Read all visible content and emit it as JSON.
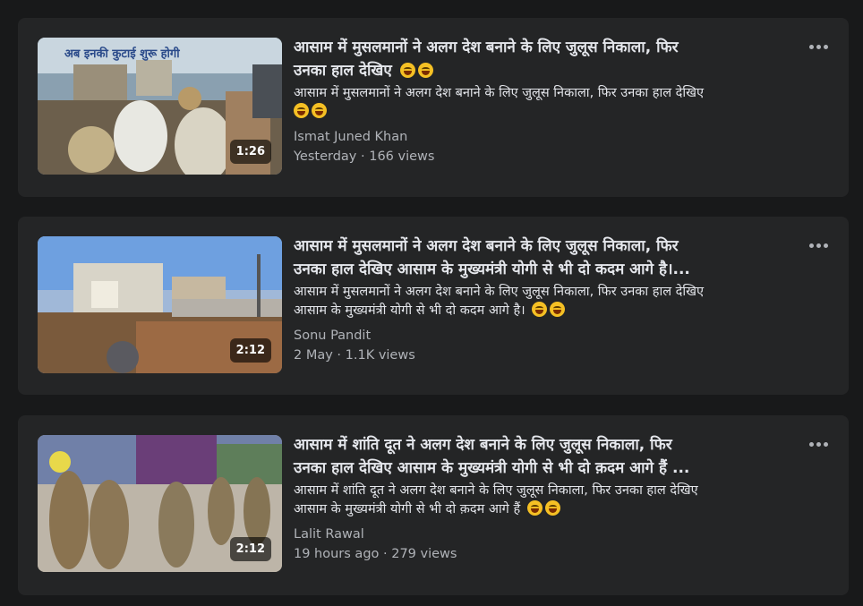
{
  "feed": {
    "items": [
      {
        "title": "आसाम में मुसलमानों ने अलग देश बनाने के लिए जुलूस निकाला, फिर",
        "title_line2": "उनका हाल देखिए",
        "title_emojis": [
          "😂",
          "😂"
        ],
        "desc_line1": "आसाम में मुसलमानों ने अलग देश बनाने के लिए जुलूस निकाला, फिर उनका हाल देखिए",
        "desc_line2": "",
        "desc_emojis": [
          "😂",
          "😂"
        ],
        "author": "Ismat Juned Khan",
        "meta": "Yesterday · 166 views",
        "duration": "1:26",
        "thumb_caption": "अब इनकी कुटाई शुरू होगी"
      },
      {
        "title": "आसाम में मुसलमानों ने अलग देश बनाने के लिए जुलूस निकाला, फिर",
        "title_line2": "उनका हाल देखिए आसाम के मुख्यमंत्री योगी से भी दो कदम आगे है।...",
        "desc_line1": "आसाम में मुसलमानों ने अलग देश बनाने के लिए जुलूस निकाला, फिर उनका हाल देखिए",
        "desc_line2": "आसाम के मुख्यमंत्री योगी से भी दो कदम आगे है।",
        "desc_emojis": [
          "😂",
          "😂"
        ],
        "author": "Sonu Pandit",
        "meta": "2 May · 1.1K views",
        "duration": "2:12"
      },
      {
        "title": "आसाम में शांति दूत ने अलग देश बनाने के लिए जुलूस निकाला, फिर",
        "title_line2": "उनका हाल देखिए आसाम के मुख्यमंत्री योगी से भी दो क़दम आगे हैं ...",
        "desc_line1": "आसाम में शांति दूत ने अलग देश बनाने के लिए जुलूस निकाला, फिर उनका हाल देखिए",
        "desc_line2": "आसाम के मुख्यमंत्री योगी से भी दो क़दम आगे हैं",
        "desc_emojis": [
          "😂",
          "😂"
        ],
        "author": "Lalit Rawal",
        "meta": "19 hours ago · 279 views",
        "duration": "2:12"
      }
    ]
  },
  "colors": {
    "page_bg": "#18191a",
    "card_bg": "#242526",
    "primary_text": "#e4e6eb",
    "secondary_text": "#b0b3b8"
  },
  "icons": {
    "more": "more-options-icon",
    "emoji": "laughing-emoji-icon"
  }
}
